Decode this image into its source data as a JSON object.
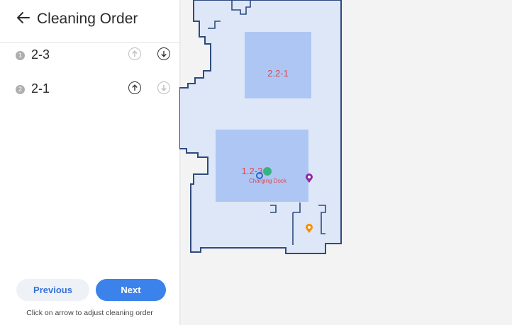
{
  "header": {
    "title": "Cleaning Order"
  },
  "order_list": [
    {
      "index": "1",
      "label": "2-3",
      "up_enabled": false,
      "down_enabled": true
    },
    {
      "index": "2",
      "label": "2-1",
      "up_enabled": true,
      "down_enabled": false
    }
  ],
  "buttons": {
    "previous": "Previous",
    "next": "Next"
  },
  "hint": "Click on arrow to adjust cleaning order",
  "map": {
    "rooms": [
      {
        "label": "2.2-1"
      },
      {
        "label": "1.2-3"
      }
    ],
    "dock_label": "Charging Dock"
  },
  "colors": {
    "accent": "#3b82ea",
    "room_fill": "#adc6f4",
    "floor_fill": "#dde7f8",
    "wall": "#2f4a7e",
    "label_red": "#e2474b"
  }
}
